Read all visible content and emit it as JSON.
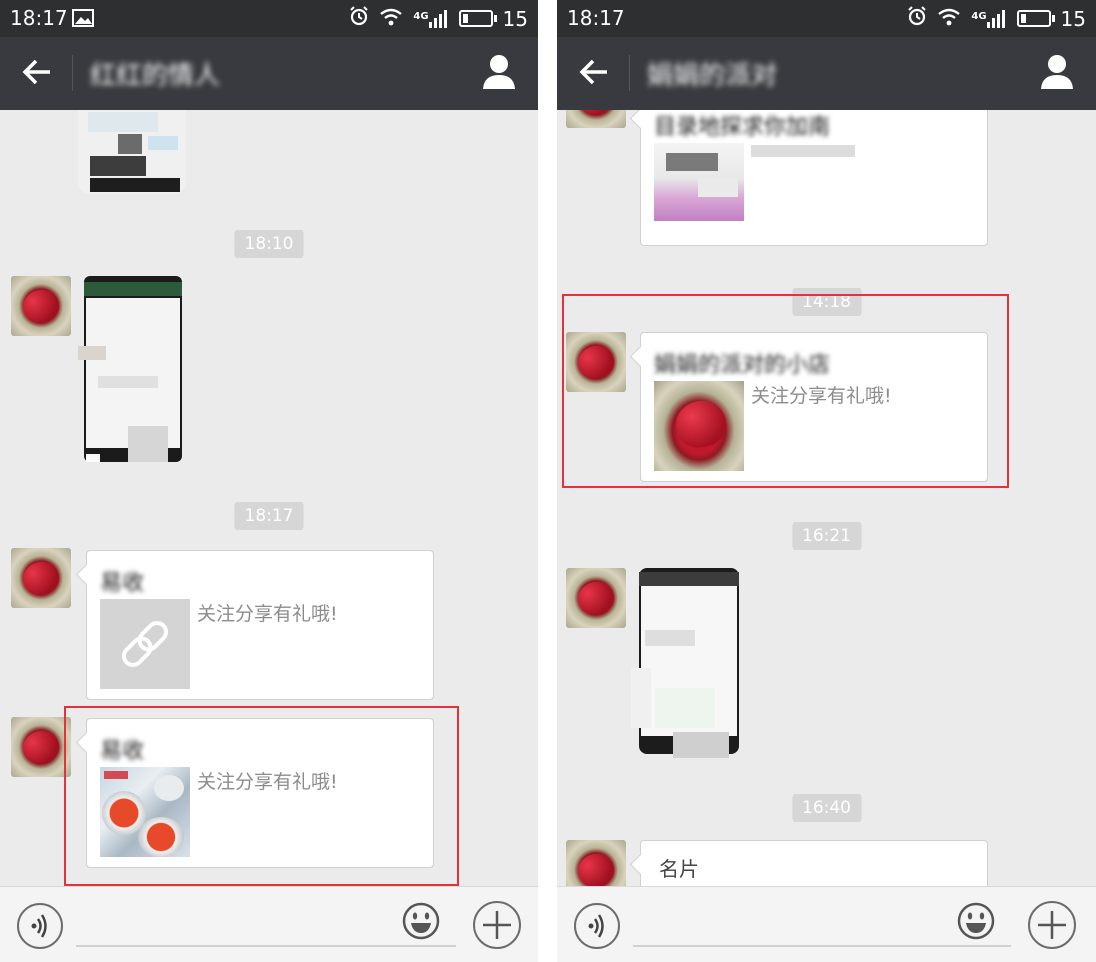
{
  "left": {
    "status": {
      "time": "18:17",
      "battery_level": "15",
      "network": "4G",
      "battery_fraction": 0.15
    },
    "nav": {
      "title": "红红的情人"
    },
    "timestamps": [
      "18:10",
      "18:17"
    ],
    "cards": [
      {
        "title": "易收",
        "desc": "关注分享有礼哦!",
        "thumb": "link-icon"
      },
      {
        "title": "易收",
        "desc": "关注分享有礼哦!",
        "thumb": "tea-cups-photo"
      }
    ]
  },
  "right": {
    "status": {
      "time": "18:17",
      "battery_level": "15",
      "network": "4G",
      "battery_fraction": 0.15
    },
    "nav": {
      "title": "娟娟的派对"
    },
    "top_card": {
      "title": "目录地探求你加南"
    },
    "timestamps": [
      "14:18",
      "16:21",
      "16:40"
    ],
    "cards": [
      {
        "title": "娟娟的派对的小店",
        "desc": "关注分享有礼哦!",
        "thumb": "heart-photo"
      },
      {
        "title": "名片"
      }
    ]
  },
  "colors": {
    "statusbar": "#2e2f31",
    "navbar": "#393a3f",
    "chat_bg": "#ebebeb",
    "highlight": "#e2333a",
    "timestamp_bg": "#d6d6d6"
  }
}
